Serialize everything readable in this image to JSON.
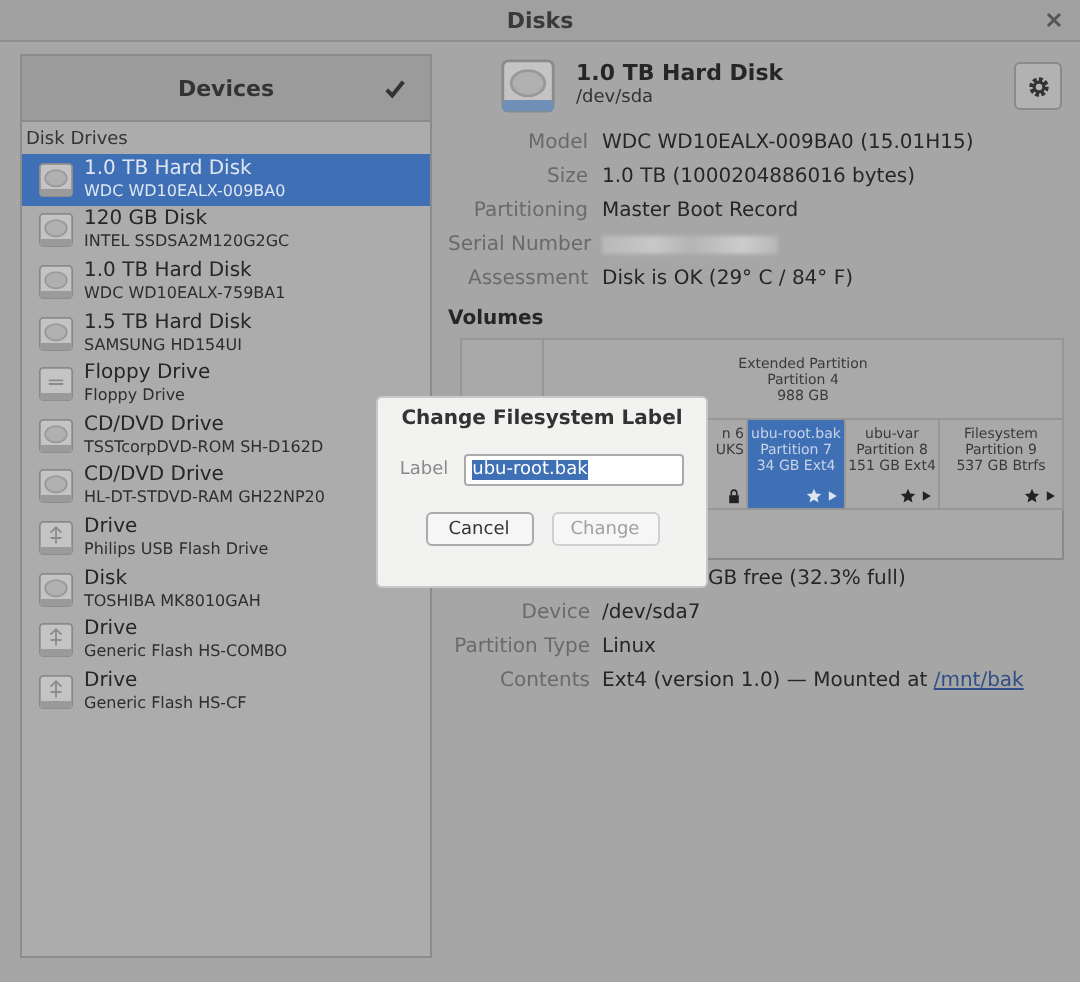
{
  "window": {
    "title": "Disks"
  },
  "sidebar": {
    "header": "Devices",
    "section": "Disk Drives",
    "items": [
      {
        "name": "1.0 TB Hard Disk",
        "model": "WDC WD10EALX-009BA0",
        "kind": "disk",
        "selected": true
      },
      {
        "name": "120 GB Disk",
        "model": "INTEL SSDSA2M120G2GC",
        "kind": "disk",
        "selected": false
      },
      {
        "name": "1.0 TB Hard Disk",
        "model": "WDC WD10EALX-759BA1",
        "kind": "disk",
        "selected": false
      },
      {
        "name": "1.5 TB Hard Disk",
        "model": "SAMSUNG HD154UI",
        "kind": "disk",
        "selected": false
      },
      {
        "name": "Floppy Drive",
        "model": "Floppy Drive",
        "kind": "floppy",
        "selected": false
      },
      {
        "name": "CD/DVD Drive",
        "model": "TSSTcorpDVD-ROM SH-D162D",
        "kind": "disk",
        "selected": false
      },
      {
        "name": "CD/DVD Drive",
        "model": "HL-DT-STDVD-RAM GH22NP20",
        "kind": "disk",
        "selected": false
      },
      {
        "name": "Drive",
        "model": "Philips USB Flash Drive",
        "kind": "usb",
        "selected": false
      },
      {
        "name": "Disk",
        "model": "TOSHIBA MK8010GAH",
        "kind": "disk",
        "selected": false
      },
      {
        "name": "Drive",
        "model": "Generic Flash HS-COMBO",
        "kind": "usb",
        "selected": false
      },
      {
        "name": "Drive",
        "model": "Generic Flash HS-CF",
        "kind": "usb",
        "selected": false
      }
    ]
  },
  "disk": {
    "title": "1.0 TB Hard Disk",
    "device": "/dev/sda",
    "properties": [
      {
        "label": "Model",
        "kind": "text",
        "value": "WDC WD10EALX-009BA0 (15.01H15)"
      },
      {
        "label": "Size",
        "kind": "text",
        "value": "1.0 TB (1000204886016 bytes)"
      },
      {
        "label": "Partitioning",
        "kind": "text",
        "value": "Master Boot Record"
      },
      {
        "label": "Serial Number",
        "kind": "redacted"
      },
      {
        "label": "Assessment",
        "kind": "text",
        "value": "Disk is OK (29° C / 84° F)"
      }
    ]
  },
  "volumes": {
    "heading": "Volumes",
    "extended": [
      "Extended Partition",
      "Partition 4",
      "988 GB"
    ],
    "partitions": [
      {
        "lines": [
          "n 6",
          "UKS"
        ],
        "selected": false,
        "mounted": false,
        "locked": true
      },
      {
        "lines": [
          "ubu-root.bak",
          "Partition 7",
          "34 GB Ext4"
        ],
        "selected": true,
        "mounted": true,
        "locked": false
      },
      {
        "lines": [
          "ubu-var",
          "Partition 8",
          "151 GB Ext4"
        ],
        "selected": false,
        "mounted": true,
        "locked": false
      },
      {
        "lines": [
          "Filesystem",
          "Partition 9",
          "537 GB Btrfs"
        ],
        "selected": false,
        "mounted": true,
        "locked": false
      }
    ],
    "details": [
      {
        "value": "GB free (32.3% full)"
      },
      {
        "label": "Device",
        "value": "/dev/sda7"
      },
      {
        "label": "Partition Type",
        "value": "Linux"
      },
      {
        "label": "Contents",
        "value": "Ext4 (version 1.0) — Mounted at ",
        "link": "/mnt/bak"
      }
    ]
  },
  "dialog": {
    "title": "Change Filesystem Label",
    "field_label": "Label",
    "value": "ubu-root.bak",
    "text_selected": true,
    "buttons": [
      {
        "label": "Cancel",
        "disabled": false
      },
      {
        "label": "Change",
        "disabled": true
      }
    ]
  }
}
